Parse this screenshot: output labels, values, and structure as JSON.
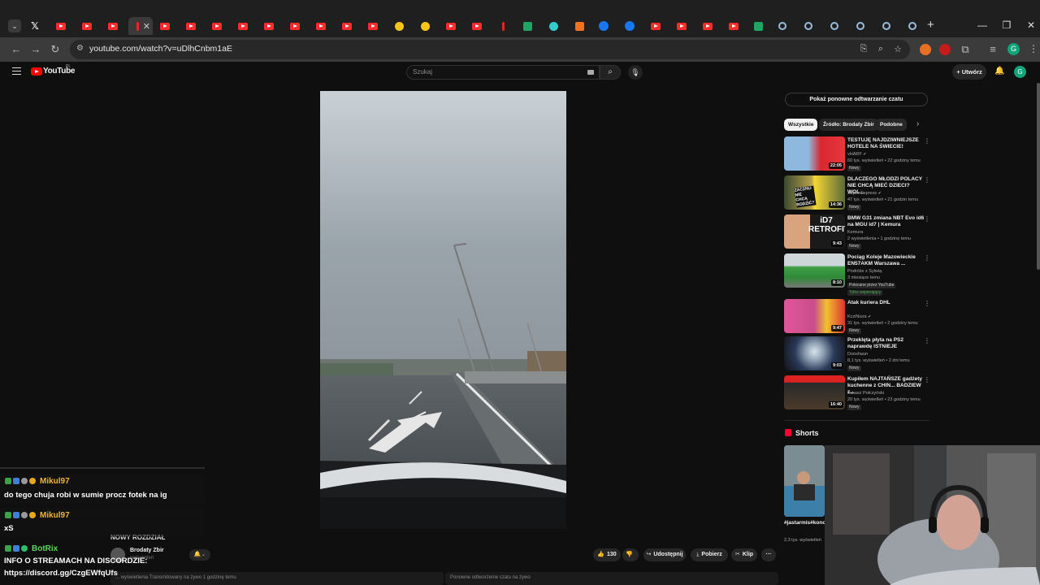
{
  "browser": {
    "url": "youtube.com/watch?v=uDlhCnbm1aE"
  },
  "youtube": {
    "logo_text": "YouTube",
    "country_code": "PL",
    "search_placeholder": "Szukaj",
    "create_label": "Utwórz",
    "avatar_letter": "G"
  },
  "actions": {
    "likes": "130",
    "share": "Udostępnij",
    "download": "Pobierz",
    "clip": "Klip"
  },
  "channel": {
    "name": "Brodaty Zbir",
    "subs": "wyświetleń"
  },
  "below_video": {
    "chapter": "NOWY ROZDZIAŁ",
    "desc_left": "... wyświetlenia  Transmitowany na żywo 1 godzinę temu",
    "desc_right": "Ponowne odtworzenie czatu na żywo"
  },
  "sidebar": {
    "chat_replay": "Pokaż ponowne odtwarzanie czatu",
    "chips": [
      "Wszystkie",
      "Źródło: Brodaty Zbir",
      "Podobne"
    ],
    "recs": [
      {
        "title": "TESTUJĘ NAJDZIWNIEJSZE HOTELE NA ŚWIECIE!",
        "channel": "vHARF",
        "meta": "60 tys. wyświetleń • 22 godziny temu",
        "badge": "Nowy",
        "duration": "22:05"
      },
      {
        "title": "DLACZEGO MŁODZI POLACY NIE CHCĄ MIEĆ DZIECI? WOL...",
        "channel": "Super Express",
        "meta": "47 tys. wyświetleń • 21 godzin temu",
        "badge": "Nowy",
        "duration": "14:36"
      },
      {
        "title": "BMW G31 zmiana NBT Evo id6 na MGU id7 | Kemura",
        "channel": "Kemura",
        "meta": "2 wyświetlenia • 1 godzinę temu",
        "badge": "Nowy",
        "duration": "9:43"
      },
      {
        "title": "Pociąg Koleje Mazowieckie EN57AKM Warszawa ...",
        "channel": "Podróże z Sylwią",
        "meta": "3 miesiące temu",
        "badge": "Polecane przez YouTube",
        "badge2": "Tylko wspierający",
        "duration": "8:10"
      },
      {
        "title": "Atak kuriera DHL",
        "channel": "KcziNiura",
        "meta": "31 tys. wyświetleń • 2 godziny temu",
        "badge": "Nowy",
        "duration": "9:47"
      },
      {
        "title": "Przeklęta płyta na PS2 naprawdę ISTNIEJE",
        "channel": "Dooshaun",
        "meta": "8,1 tys. wyświetleń • 2 dni temu",
        "badge": "Nowy",
        "duration": "9:03"
      },
      {
        "title": "Kupiłem NAJTAŃSZE gadżety kuchenne z CHIN... BADZIEW z...",
        "channel": "Łukasz Połczyński",
        "meta": "20 tys. wyświetleń • 23 godziny temu",
        "badge": "Nowy",
        "duration": "16:40"
      }
    ],
    "shorts_label": "Shorts",
    "short": {
      "title": "#jastarmis#koncert#ody...",
      "views": "2,3 tys. wyświetleń"
    }
  },
  "thumb_text": {
    "rec2_overlay": "ZACZNIJ NIE CHCĄ RODZIĆ?",
    "rec3_overlay": "iD7 RETROFIT"
  },
  "chat": {
    "messages": [
      {
        "user": "Mikul97",
        "text": "do tego chuja robi w sumie procz fotek na ig"
      },
      {
        "user": "Mikul97",
        "text": "xS"
      },
      {
        "user": "BotRix",
        "text": "INFO O STREAMACH NA DISCORDZIE:",
        "text2": "https://discord.gg/CzgEWfqUfs"
      }
    ]
  },
  "colors": {
    "yt_red": "#ff0000",
    "bg": "#0f0f0f",
    "chat_name": "#f0b43c",
    "bot_name": "#5fd35f"
  }
}
